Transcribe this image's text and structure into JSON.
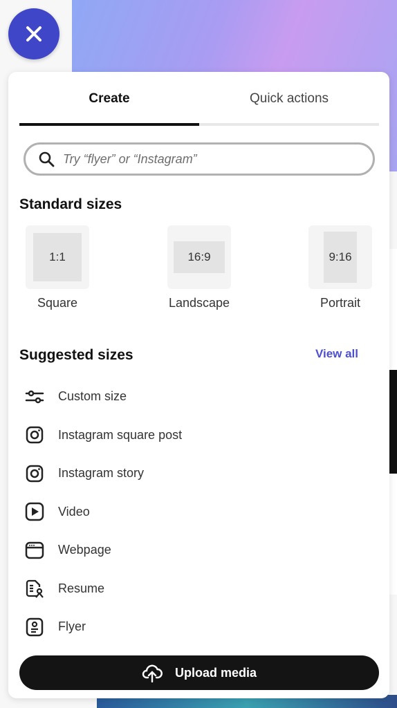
{
  "close_button": {
    "icon": "close-icon",
    "color": "#4046c8"
  },
  "tabs": [
    {
      "label": "Create",
      "active": true
    },
    {
      "label": "Quick actions",
      "active": false
    }
  ],
  "search": {
    "placeholder": "Try “flyer” or “Instagram”",
    "value": ""
  },
  "standard_sizes": {
    "title": "Standard sizes",
    "items": [
      {
        "ratio": "1:1",
        "label": "Square"
      },
      {
        "ratio": "16:9",
        "label": "Landscape"
      },
      {
        "ratio": "9:16",
        "label": "Portrait"
      }
    ]
  },
  "suggested_sizes": {
    "title": "Suggested sizes",
    "view_all": "View all",
    "items": [
      {
        "label": "Custom size",
        "icon": "sliders-icon"
      },
      {
        "label": "Instagram square post",
        "icon": "instagram-icon"
      },
      {
        "label": "Instagram story",
        "icon": "instagram-icon"
      },
      {
        "label": "Video",
        "icon": "play-icon"
      },
      {
        "label": "Webpage",
        "icon": "browser-icon"
      },
      {
        "label": "Resume",
        "icon": "resume-icon"
      },
      {
        "label": "Flyer",
        "icon": "flyer-icon"
      }
    ]
  },
  "upload_button": {
    "label": "Upload media",
    "icon": "cloud-upload-icon"
  },
  "accent_color": "#4b4fd0"
}
